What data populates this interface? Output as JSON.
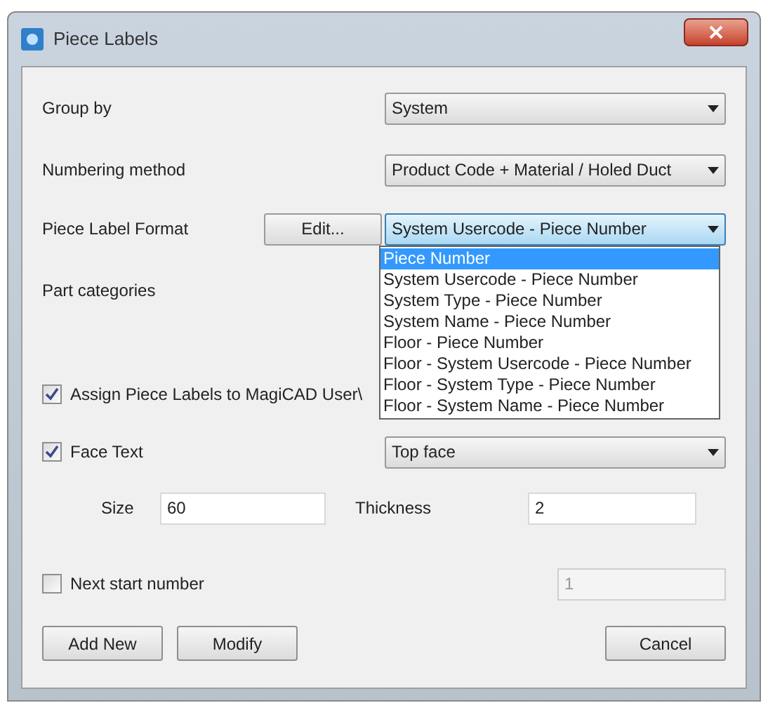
{
  "window": {
    "title": "Piece Labels"
  },
  "group_by": {
    "label": "Group by",
    "value": "System"
  },
  "numbering_method": {
    "label": "Numbering method",
    "value": "Product Code + Material / Holed Duct"
  },
  "piece_label_format": {
    "label": "Piece Label Format",
    "edit_button": "Edit...",
    "value": "System Usercode - Piece Number",
    "expanded": true,
    "options": [
      {
        "label": "Piece Number",
        "highlighted": true
      },
      {
        "label": "System Usercode - Piece Number",
        "highlighted": false
      },
      {
        "label": "System Type - Piece Number",
        "highlighted": false
      },
      {
        "label": "System Name - Piece Number",
        "highlighted": false
      },
      {
        "label": "Floor - Piece Number",
        "highlighted": false
      },
      {
        "label": "Floor - System Usercode - Piece Number",
        "highlighted": false
      },
      {
        "label": "Floor - System Type - Piece Number",
        "highlighted": false
      },
      {
        "label": "Floor - System Name - Piece Number",
        "highlighted": false
      }
    ]
  },
  "part_categories": {
    "label": "Part categories"
  },
  "assign": {
    "label": "Assign Piece Labels to MagiCAD User\\",
    "checked": true
  },
  "face_text": {
    "label": "Face Text",
    "checked": true,
    "value": "Top face"
  },
  "size": {
    "label": "Size",
    "value": "60"
  },
  "thickness": {
    "label": "Thickness",
    "value": "2"
  },
  "next_start": {
    "label": "Next start number",
    "checked": false,
    "value": "1",
    "disabled": true
  },
  "buttons": [
    "Add New",
    "Modify",
    "Cancel"
  ]
}
